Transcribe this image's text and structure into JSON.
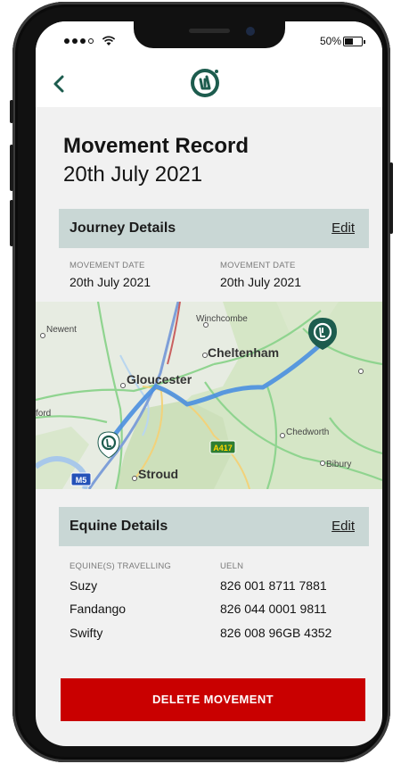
{
  "status_bar": {
    "battery_text": "50%",
    "battery_level": 0.5
  },
  "colors": {
    "brand": "#1d5c4e",
    "delete": "#c90000",
    "section_header": "#c9d7d5",
    "route": "#4a8fe0"
  },
  "nav": {
    "back_icon": "chevron-left-icon",
    "logo_icon": "brand-logo-icon"
  },
  "page": {
    "title": "Movement Record",
    "subtitle": "20th July 2021"
  },
  "journey": {
    "header": "Journey Details",
    "edit_label": "Edit",
    "fields": [
      {
        "label": "MOVEMENT DATE",
        "value": "20th July 2021"
      },
      {
        "label": "MOVEMENT DATE",
        "value": "20th July 2021"
      }
    ]
  },
  "map": {
    "places": {
      "winchcombe": "Winchcombe",
      "newent": "Newent",
      "cheltenham": "Cheltenham",
      "gloucester": "Gloucester",
      "ford": "ford",
      "chedworth": "Chedworth",
      "bibury": "Bibury",
      "stroud": "Stroud"
    },
    "road_labels": {
      "a417": "A417",
      "m5": "M5"
    }
  },
  "equine": {
    "header": "Equine Details",
    "edit_label": "Edit",
    "col_name_label": "EQUINE(S) TRAVELLING",
    "col_ueln_label": "UELN",
    "rows": [
      {
        "name": "Suzy",
        "ueln": "826 001 8711 7881"
      },
      {
        "name": "Fandango",
        "ueln": "826 044 0001 9811"
      },
      {
        "name": "Swifty",
        "ueln": "826 008 96GB 4352"
      }
    ]
  },
  "actions": {
    "delete_label": "DELETE MOVEMENT"
  }
}
